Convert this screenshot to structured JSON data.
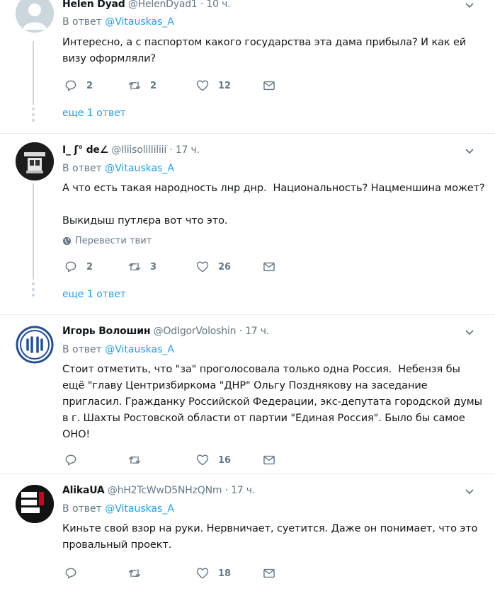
{
  "tweets": [
    {
      "name": "Helen Dyad",
      "handle": "@HelenDyad1",
      "sep": "·",
      "time": "10 ч.",
      "reply_prefix": "В ответ",
      "reply_to": "@Vitauskas_A",
      "text": "Интересно, а с паспортом какого государства эта дама прибыла? И как ей\nвизу оформляли?",
      "replies": "2",
      "retweets": "2",
      "likes": "12",
      "more": "еще 1 ответ",
      "avatar": "default-avatar"
    },
    {
      "name": "I_ ʃ° de∠",
      "handle": "@IliisolilIiliii",
      "sep": "·",
      "time": "17 ч.",
      "reply_prefix": "В ответ",
      "reply_to": "@Vitauskas_A",
      "text": "А что есть такая народность лнр днр.  Национальность? Нацменшина может?\n\nВыкидыш путлєра вот что это.",
      "translate": "Перевести твит",
      "replies": "2",
      "retweets": "3",
      "likes": "26",
      "more": "еще 1 ответ",
      "avatar": "dark-photo-avatar"
    },
    {
      "name": "Игорь Волошин",
      "handle": "@OdIgorVoloshin",
      "sep": "·",
      "time": "17 ч.",
      "reply_prefix": "В ответ",
      "reply_to": "@Vitauskas_A",
      "text": "Стоит отметить, что \"за\" проголосовала только одна Россия.  Небензя бы\nещё \"главу Центризбиркома \"ДНР\" Ольгу Позднякову на заседание\nпригласил. Гражданку Российской Федерации, экс-депутата городской думы\nв г. Шахты Ростовской области от партии \"Единая Россия\". Было бы самое\nОНО!",
      "replies": "",
      "retweets": "",
      "likes": "16",
      "avatar": "blue-logo-avatar"
    },
    {
      "name": "AlikaUA",
      "handle": "@hH2TcWwD5NHzQNm",
      "sep": "·",
      "time": "17 ч.",
      "reply_prefix": "В ответ",
      "reply_to": "@Vitauskas_A",
      "text": "Киньте свой взор на руки. Нервничает, суетится. Даже он понимает, что это\nпровальный проект.",
      "replies": "",
      "retweets": "",
      "likes": "18",
      "avatar": "save-oleg-sentsov-avatar"
    }
  ],
  "colors": {
    "accent": "#1da1f2",
    "muted": "#657786",
    "line": "#ccd6dd",
    "text": "#14171a"
  }
}
